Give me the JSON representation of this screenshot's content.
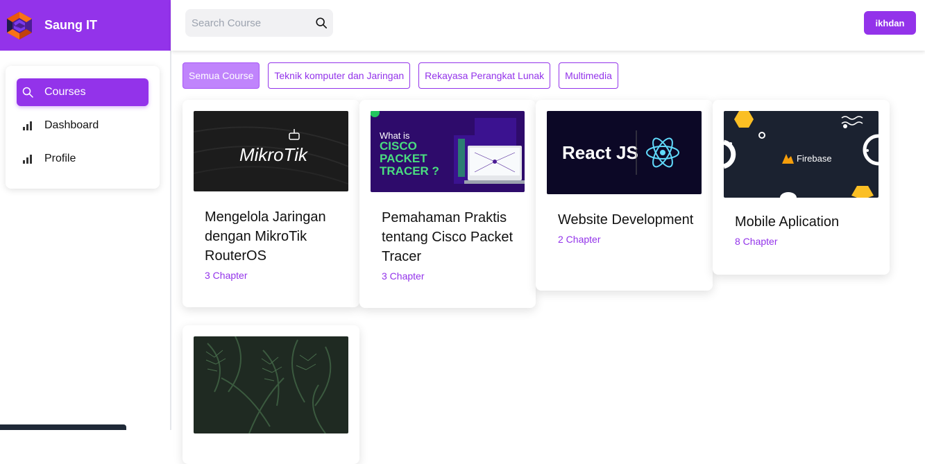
{
  "brand": {
    "name": "Saung IT"
  },
  "search": {
    "placeholder": "Search Course"
  },
  "user": {
    "name": "ikhdan"
  },
  "sidebar": {
    "items": [
      {
        "label": "Courses",
        "icon": "search-icon",
        "active": true
      },
      {
        "label": "Dashboard",
        "icon": "bar-chart-icon",
        "active": false
      },
      {
        "label": "Profile",
        "icon": "bar-chart-icon",
        "active": false
      }
    ]
  },
  "filters": [
    {
      "label": "Semua Course",
      "active": true
    },
    {
      "label": "Teknik komputer dan Jaringan",
      "active": false
    },
    {
      "label": "Rekayasa Perangkat Lunak",
      "active": false
    },
    {
      "label": "Multimedia",
      "active": false
    }
  ],
  "courses": [
    {
      "title": "Mengelola Jaringan dengan MikroTik RouterOS",
      "chapters": "3 Chapter",
      "thumb_text": "MikroTik"
    },
    {
      "title": "Pemahaman Praktis tentang Cisco Packet Tracer",
      "chapters": "3 Chapter",
      "thumb_text": "What is CISCO PACKET TRACER ?"
    },
    {
      "title": "Website Development",
      "chapters": "2 Chapter",
      "thumb_text": "React JS"
    },
    {
      "title": "Mobile Aplication",
      "chapters": "8 Chapter",
      "thumb_text": "Firebase"
    },
    {
      "title": "",
      "chapters": "",
      "thumb_text": ""
    }
  ],
  "colors": {
    "accent": "#9333ea",
    "accent_light": "#c084fc"
  }
}
